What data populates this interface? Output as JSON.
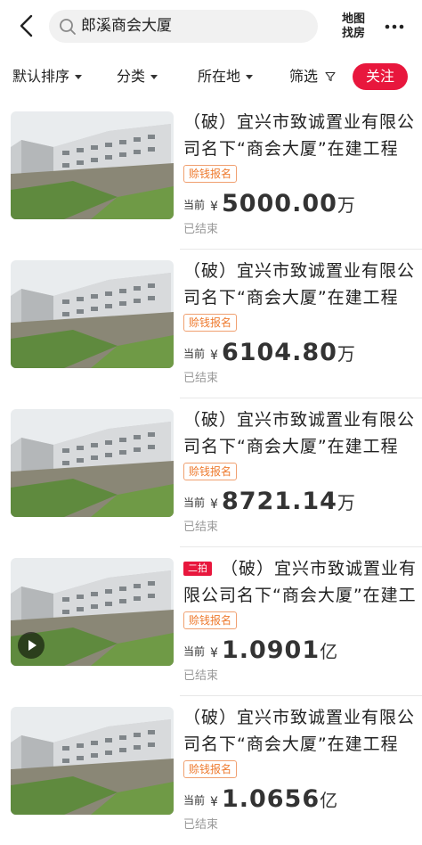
{
  "header": {
    "search_text": "郎溪商会大厦",
    "map_label_1": "地图",
    "map_label_2": "找房"
  },
  "filters": {
    "sort": "默认排序",
    "category": "分类",
    "location": "所在地",
    "filter": "筛选",
    "follow": "关注"
  },
  "items": [
    {
      "title": "（破）宜兴市致诚置业有限公司名下“商会大厦”在建工程",
      "tag": "赊钱报名",
      "price_label": "当前",
      "currency": "¥",
      "price": "5000.00",
      "unit": "万",
      "status": "已结束"
    },
    {
      "title": "（破）宜兴市致诚置业有限公司名下“商会大厦”在建工程",
      "tag": "赊钱报名",
      "price_label": "当前",
      "currency": "¥",
      "price": "6104.80",
      "unit": "万",
      "status": "已结束"
    },
    {
      "title": "（破）宜兴市致诚置业有限公司名下“商会大厦”在建工程",
      "tag": "赊钱报名",
      "price_label": "当前",
      "currency": "¥",
      "price": "8721.14",
      "unit": "万",
      "status": "已结束"
    },
    {
      "round_tag": "二拍",
      "title": "（破）宜兴市致诚置业有限公司名下“商会大厦”在建工程",
      "tag": "赊钱报名",
      "price_label": "当前",
      "currency": "¥",
      "price": "1.0901",
      "unit": "亿",
      "status": "已结束"
    },
    {
      "title": "（破）宜兴市致诚置业有限公司名下“商会大厦”在建工程",
      "tag": "赊钱报名",
      "price_label": "当前",
      "currency": "¥",
      "price": "1.0656",
      "unit": "亿",
      "status": "已结束"
    }
  ]
}
